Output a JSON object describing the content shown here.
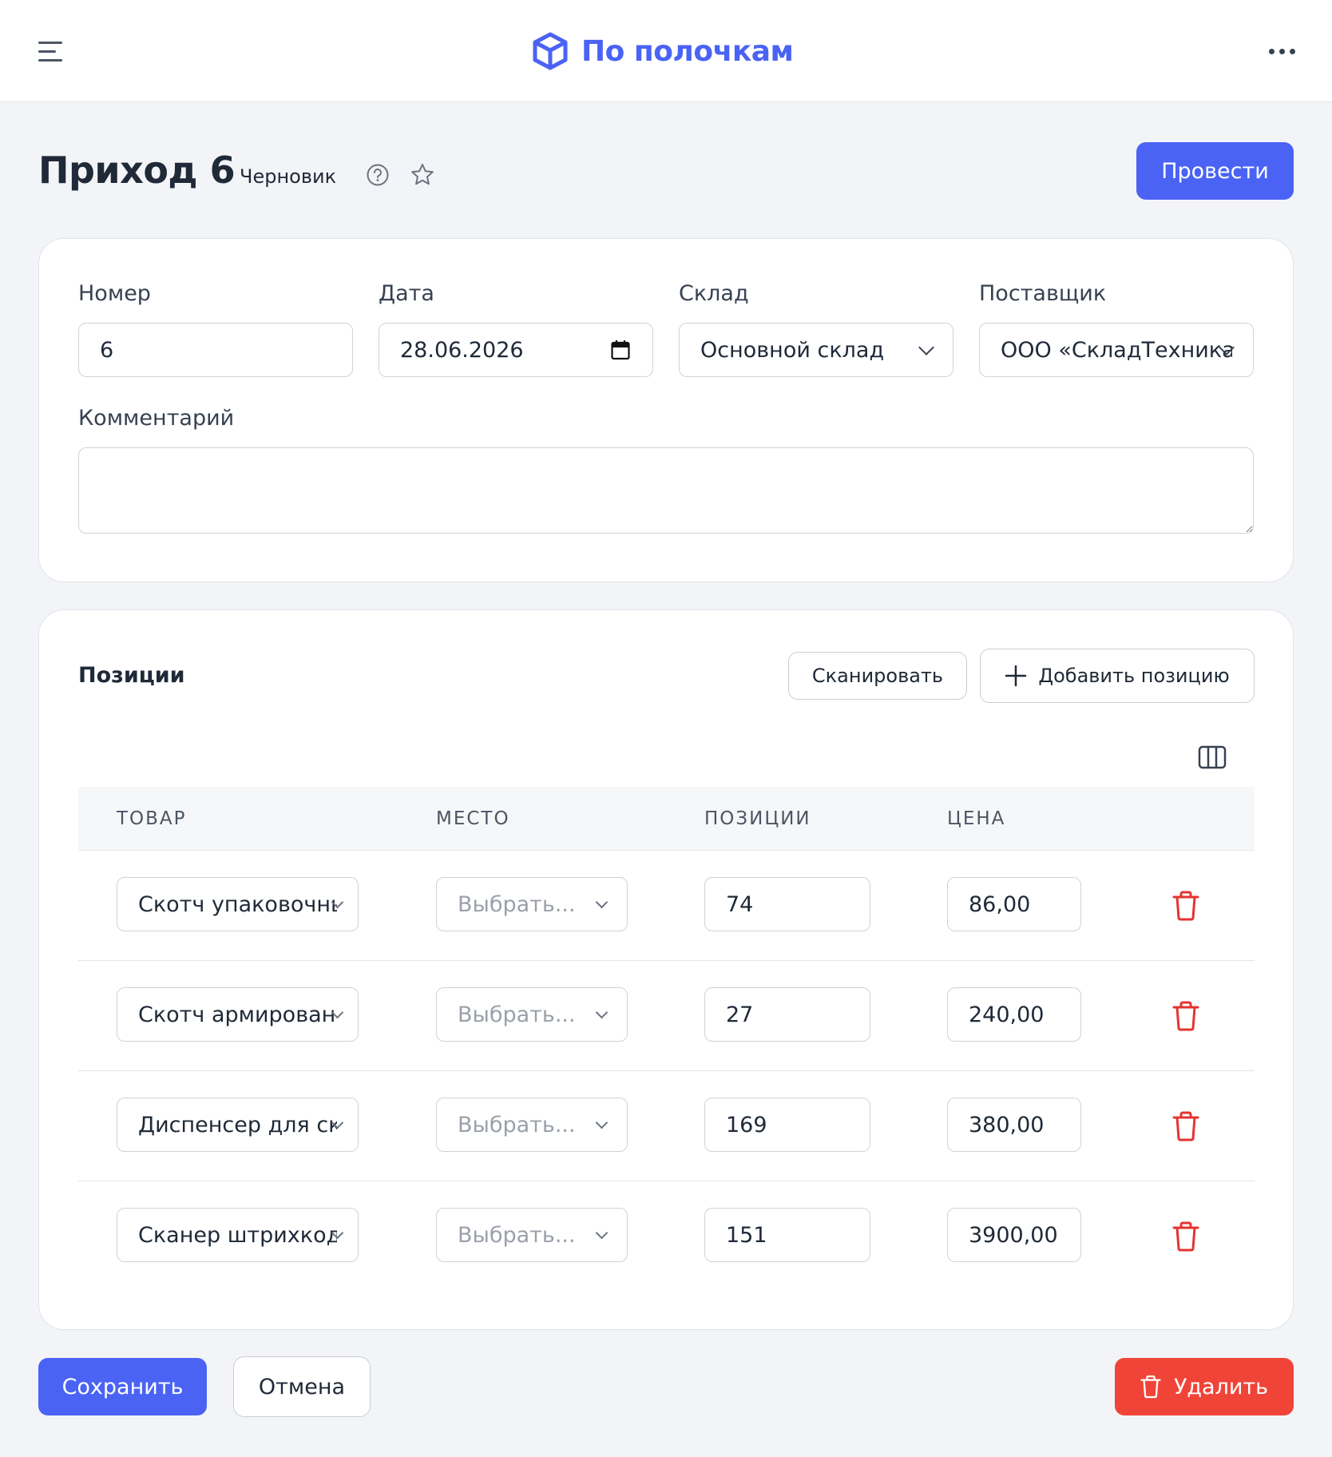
{
  "app": {
    "brand_name": "По полочкам",
    "brand_color": "#4a63f5"
  },
  "header_icons": {
    "menu": "menu-icon",
    "more": "more-horizontal-icon",
    "logo": "box-icon"
  },
  "document": {
    "title": "Приход 6",
    "status": "Черновик",
    "post_label": "Провести"
  },
  "form": {
    "number": {
      "label": "Номер",
      "value": "6"
    },
    "date": {
      "label": "Дата",
      "value": "28.06.2026"
    },
    "warehouse": {
      "label": "Склад",
      "value": "Основной склад"
    },
    "supplier": {
      "label": "Поставщик",
      "value": "ООО «СкладТехника»"
    },
    "comment": {
      "label": "Комментарий",
      "value": ""
    }
  },
  "positions": {
    "title": "Позиции",
    "scan_label": "Сканировать",
    "add_label": "Добавить позицию",
    "columns": [
      "ТОВАР",
      "МЕСТО",
      "ПОЗИЦИИ",
      "ЦЕНА"
    ],
    "location_placeholder": "Выбрать...",
    "rows": [
      {
        "product": "Скотч упаковочный",
        "location": "",
        "quantity": "74",
        "price": "86,00"
      },
      {
        "product": "Скотч армированный",
        "location": "",
        "quantity": "27",
        "price": "240,00"
      },
      {
        "product": "Диспенсер для скотча",
        "location": "",
        "quantity": "169",
        "price": "380,00"
      },
      {
        "product": "Сканер штрихкодов",
        "location": "",
        "quantity": "151",
        "price": "3900,00"
      }
    ]
  },
  "footer": {
    "save_label": "Сохранить",
    "cancel_label": "Отмена",
    "delete_label": "Удалить"
  },
  "colors": {
    "primary": "#4a63f5",
    "danger": "#f04438",
    "background": "#f3f4f7"
  }
}
